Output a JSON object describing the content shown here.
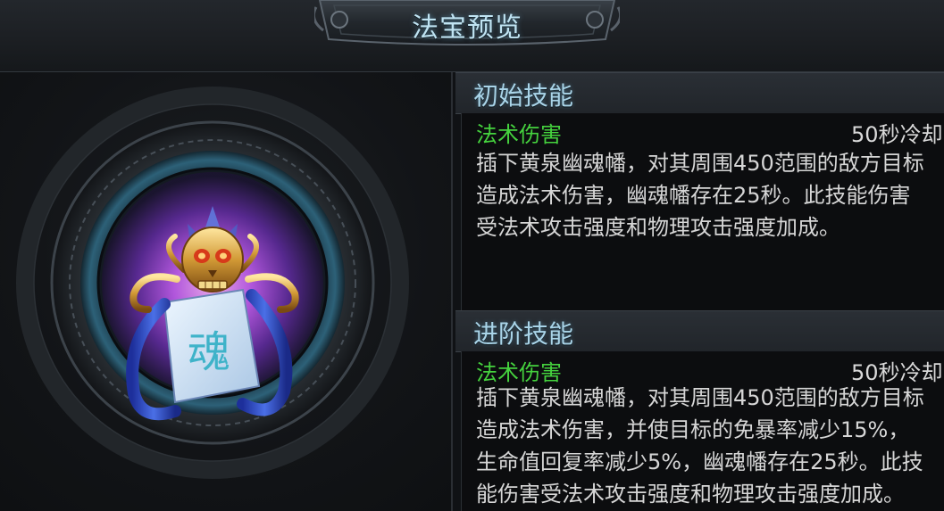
{
  "window": {
    "title": "法宝预览"
  },
  "artifact": {
    "emblem_glyph": "魂"
  },
  "skills": {
    "initial": {
      "header": "初始技能",
      "name": "法术伤害",
      "cooldown": "50秒冷却",
      "desc_lines": [
        "插下黄泉幽魂幡，对其周围450范围的敌方目标",
        "造成法术伤害，幽魂幡存在25秒。此技能伤害",
        "受法术攻击强度和物理攻击强度加成。"
      ]
    },
    "advanced": {
      "header": "进阶技能",
      "name": "法术伤害",
      "cooldown": "50秒冷却",
      "desc_lines": [
        "插下黄泉幽魂幡，对其周围450范围的敌方目标",
        "造成法术伤害，并使目标的免暴率减少15%，",
        "生命值回复率减少5%，幽魂幡存在25秒。此技",
        "能伤害受法术攻击强度和物理攻击强度加成。"
      ]
    }
  },
  "colors": {
    "skill_name": "#45d23e",
    "header_text": "#a9d4e8",
    "body_text": "#d6d6d6"
  }
}
